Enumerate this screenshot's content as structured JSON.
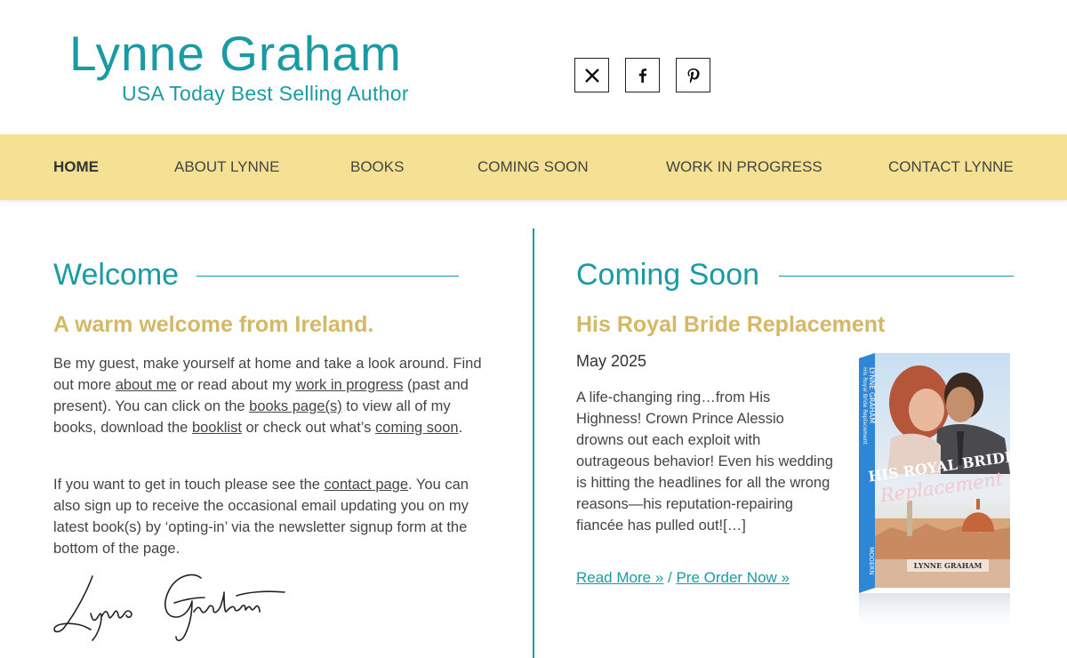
{
  "header": {
    "title": "Lynne Graham",
    "tagline": "USA Today Best Selling Author",
    "social": [
      {
        "name": "x-icon",
        "glyph": "X"
      },
      {
        "name": "facebook-icon",
        "glyph": "f"
      },
      {
        "name": "pinterest-icon",
        "glyph": "P"
      }
    ]
  },
  "nav": {
    "items": [
      {
        "label": "HOME",
        "active": true
      },
      {
        "label": "ABOUT LYNNE",
        "active": false
      },
      {
        "label": "BOOKS",
        "active": false
      },
      {
        "label": "COMING SOON",
        "active": false
      },
      {
        "label": "WORK IN PROGRESS",
        "active": false
      },
      {
        "label": "CONTACT LYNNE",
        "active": false
      }
    ]
  },
  "welcome": {
    "heading": "Welcome",
    "subheading": "A warm welcome from Ireland.",
    "p1": {
      "t1": "Be my guest, make yourself at home and take a look around. Find out more ",
      "l1": "about me",
      "t2": " or read about my ",
      "l2": "work in progress",
      "t3": " (past and present). You can click on the ",
      "l3": "books page(s)",
      "t4": " to view all of my books, download the ",
      "l4": "booklist",
      "t5": " or check out what’s ",
      "l5": "coming soon",
      "t6": "."
    },
    "p2": {
      "t1": "If you want to get in touch please see the ",
      "l1": "contact page",
      "t2": ". You can also sign up to receive the occasional email updating you on my latest book(s) by ‘opting-in’ via the newsletter signup form at the bottom of the page."
    },
    "signature": "Lynne Graham"
  },
  "coming_soon": {
    "heading": "Coming Soon",
    "book_title": "His Royal Bride Replacement",
    "release": "May 2025",
    "blurb": "A life-changing ring…from His Highness! Crown Prince Alessio drowns out each exploit with outrageous behavior! Even his wedding is hitting the headlines for all the wrong reasons—his reputation-repairing fiancée has pulled out![…]",
    "read_more": "Read More »",
    "separator": " / ",
    "pre_order": "Pre Order Now »",
    "cover": {
      "author_spine": "LYNNE GRAHAM",
      "title_spine": "His Royal Bride Replacement",
      "cover_title_line1": "HIS ROYAL BRIDE",
      "cover_title_line2": "Replacement",
      "cover_author": "LYNNE GRAHAM",
      "publisher": "MODERN"
    }
  },
  "colors": {
    "teal": "#1a9ba3",
    "gold": "#d4b865",
    "nav_bg": "#f5e193"
  }
}
